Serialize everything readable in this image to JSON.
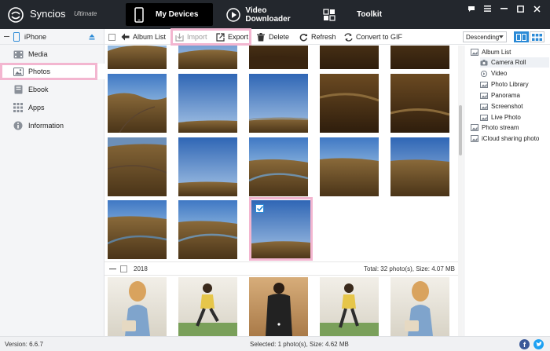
{
  "app": {
    "name": "Syncios",
    "edition": "Ultimate"
  },
  "nav": {
    "tabs": [
      {
        "label": "My Devices",
        "icon": "phone-icon",
        "active": true
      },
      {
        "label": "Video Downloader",
        "icon": "play-icon",
        "active": false
      },
      {
        "label": "Toolkit",
        "icon": "toolkit-grid-icon",
        "active": false
      }
    ]
  },
  "sidebar": {
    "device": "iPhone",
    "items": [
      {
        "label": "Media",
        "icon": "media-icon"
      },
      {
        "label": "Photos",
        "icon": "photos-icon",
        "selected": true
      },
      {
        "label": "Ebook",
        "icon": "ebook-icon"
      },
      {
        "label": "Apps",
        "icon": "apps-icon"
      },
      {
        "label": "Information",
        "icon": "information-icon"
      }
    ]
  },
  "toolbar": {
    "album_list": "Album List",
    "import": "Import",
    "export": "Export",
    "delete": "Delete",
    "refresh": "Refresh",
    "convert_gif": "Convert to GIF",
    "sort": "Descending"
  },
  "grid": {
    "group_year": "2018",
    "group_total": "Total: 32 photo(s), Size: 4.07 MB"
  },
  "right_panel": {
    "items": [
      {
        "label": "Album List",
        "level": 0
      },
      {
        "label": "Camera Roll",
        "level": 1,
        "selected": true
      },
      {
        "label": "Video",
        "level": 1
      },
      {
        "label": "Photo Library",
        "level": 1
      },
      {
        "label": "Panorama",
        "level": 1
      },
      {
        "label": "Screenshot",
        "level": 1
      },
      {
        "label": "Live Photo",
        "level": 1
      },
      {
        "label": "Photo stream",
        "level": 0
      },
      {
        "label": "iCloud sharing photo",
        "level": 0
      }
    ]
  },
  "status": {
    "version": "Version: 6.6.7",
    "selected": "Selected: 1 photo(s), Size: 4.62 MB"
  },
  "colors": {
    "titlebar": "#23272d",
    "accent": "#2b8ad6",
    "highlight": "#f3b6d0",
    "facebook": "#3b5998",
    "twitter": "#1da1f2"
  }
}
